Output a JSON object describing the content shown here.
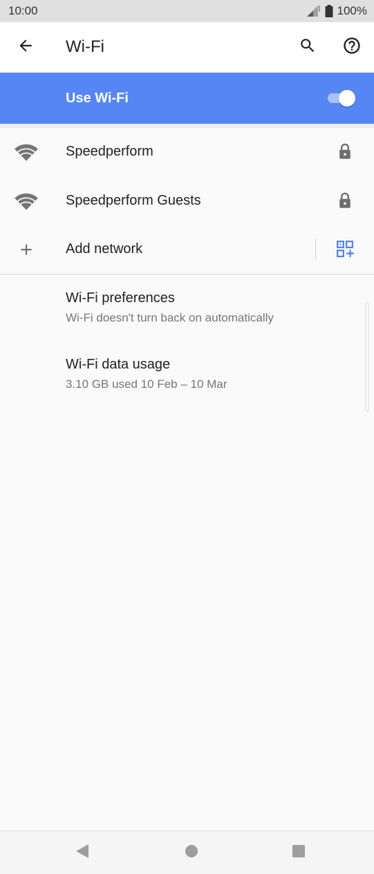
{
  "status_bar": {
    "time": "10:00",
    "battery": "100%",
    "icons": [
      "signal-icon",
      "battery-icon"
    ]
  },
  "app_bar": {
    "title": "Wi-Fi",
    "icons": [
      "back-arrow-icon",
      "search-icon",
      "help-icon"
    ]
  },
  "master_switch": {
    "label": "Use Wi-Fi",
    "on": true,
    "color": "#5586f4"
  },
  "networks": [
    {
      "name": "Speedperform",
      "icon": "wifi-icon",
      "secured": true,
      "trail_icon": "lock-icon"
    },
    {
      "name": "Speedperform Guests",
      "icon": "wifi-icon",
      "secured": true,
      "trail_icon": "lock-icon"
    }
  ],
  "add_network": {
    "label": "Add network",
    "icon": "plus-icon",
    "trail_icon": "qr-code-scan-icon"
  },
  "preferences": [
    {
      "title": "Wi-Fi preferences",
      "summary": "Wi-Fi doesn't turn back on automatically"
    },
    {
      "title": "Wi-Fi data usage",
      "summary": "3.10 GB used 10 Feb – 10 Mar"
    }
  ],
  "nav_bar": {
    "icons": [
      "nav-back-icon",
      "nav-home-icon",
      "nav-recents-icon"
    ]
  },
  "colors": {
    "accent": "#5586f4",
    "qr_icon": "#4c7fe6"
  }
}
